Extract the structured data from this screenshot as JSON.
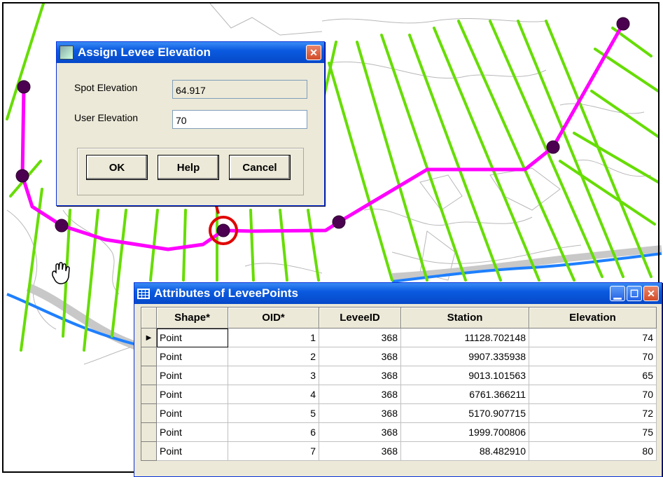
{
  "dialog": {
    "title": "Assign Levee  Elevation",
    "spot_label": "Spot Elevation",
    "spot_value": "64.917",
    "user_label": "User Elevation",
    "user_value": "70",
    "ok": "OK",
    "help": "Help",
    "cancel": "Cancel"
  },
  "table": {
    "title": "Attributes of LeveePoints",
    "columns": [
      "Shape*",
      "OID*",
      "LeveeID",
      "Station",
      "Elevation"
    ],
    "rows": [
      [
        "Point",
        "1",
        "368",
        "11128.702148",
        "74"
      ],
      [
        "Point",
        "2",
        "368",
        "9907.335938",
        "70"
      ],
      [
        "Point",
        "3",
        "368",
        "9013.101563",
        "65"
      ],
      [
        "Point",
        "4",
        "368",
        "6761.366211",
        "70"
      ],
      [
        "Point",
        "5",
        "368",
        "5170.907715",
        "72"
      ],
      [
        "Point",
        "6",
        "368",
        "1999.700806",
        "75"
      ],
      [
        "Point",
        "7",
        "368",
        "88.482910",
        "80"
      ]
    ]
  },
  "map": {
    "levee_color": "#ff00ff",
    "crossline_color": "#66dd00",
    "stream_color": "#1e7fff",
    "point_color": "#4b0050",
    "highlight_color": "#e00000"
  },
  "icons": [
    "table-icon",
    "window-app-icon",
    "close-icon",
    "minimize-icon",
    "maximize-icon",
    "pan-hand-icon",
    "row-selector-icon"
  ]
}
